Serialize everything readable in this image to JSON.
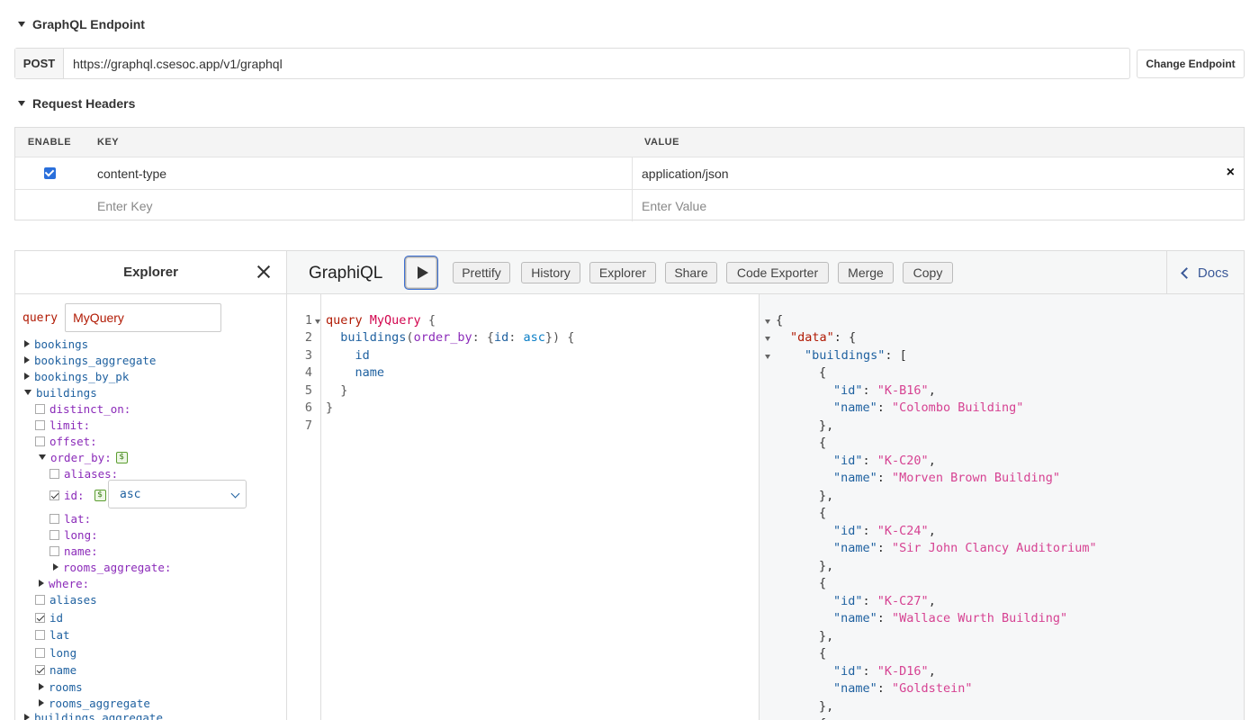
{
  "endpoint": {
    "section_title": "GraphQL Endpoint",
    "method": "POST",
    "url": "https://graphql.csesoc.app/v1/graphql",
    "change_button": "Change Endpoint"
  },
  "headers": {
    "section_title": "Request Headers",
    "columns": [
      "ENABLE",
      "KEY",
      "VALUE"
    ],
    "rows": [
      {
        "enabled": true,
        "key": "content-type",
        "value": "application/json"
      }
    ],
    "new_row": {
      "key_placeholder": "Enter Key",
      "value_placeholder": "Enter Value"
    }
  },
  "explorer": {
    "title": "Explorer",
    "query_keyword": "query",
    "query_name": "MyQuery",
    "tree": {
      "bookings": "bookings",
      "bookings_aggregate": "bookings_aggregate",
      "bookings_by_pk": "bookings_by_pk",
      "buildings": "buildings",
      "distinct_on": "distinct_on:",
      "limit": "limit:",
      "offset": "offset:",
      "order_by": "order_by:",
      "aliases_arg": "aliases:",
      "id_arg": "id:",
      "id_value": "asc",
      "lat_arg": "lat:",
      "long_arg": "long:",
      "name_arg": "name:",
      "rooms_aggregate_arg": "rooms_aggregate:",
      "where": "where:",
      "aliases": "aliases",
      "id": "id",
      "lat": "lat",
      "long": "long",
      "name": "name",
      "rooms": "rooms",
      "rooms_aggregate": "rooms_aggregate",
      "buildings_aggregate": "buildings_aggregate"
    },
    "var_badge": "$"
  },
  "graphiql": {
    "title": "GraphiQL",
    "toolbar": [
      "Prettify",
      "History",
      "Explorer",
      "Share",
      "Code Exporter",
      "Merge",
      "Copy"
    ],
    "docs": "Docs"
  },
  "query_editor": {
    "line_numbers": [
      "1",
      "2",
      "3",
      "4",
      "5",
      "6",
      "7"
    ],
    "keyword": "query",
    "name": "MyQuery",
    "field": "buildings",
    "arg": "order_by",
    "arg_key": "id",
    "arg_value": "asc",
    "sub1": "id",
    "sub2": "name"
  },
  "result": {
    "data_key": "\"data\"",
    "buildings_key": "\"buildings\"",
    "id_key": "\"id\"",
    "name_key": "\"name\"",
    "items": [
      {
        "id": "\"K-B16\"",
        "name": "\"Colombo Building\""
      },
      {
        "id": "\"K-C20\"",
        "name": "\"Morven Brown Building\""
      },
      {
        "id": "\"K-C24\"",
        "name": "\"Sir John Clancy Auditorium\""
      },
      {
        "id": "\"K-C27\"",
        "name": "\"Wallace Wurth Building\""
      },
      {
        "id": "\"K-D16\"",
        "name": "\"Goldstein\""
      }
    ]
  }
}
